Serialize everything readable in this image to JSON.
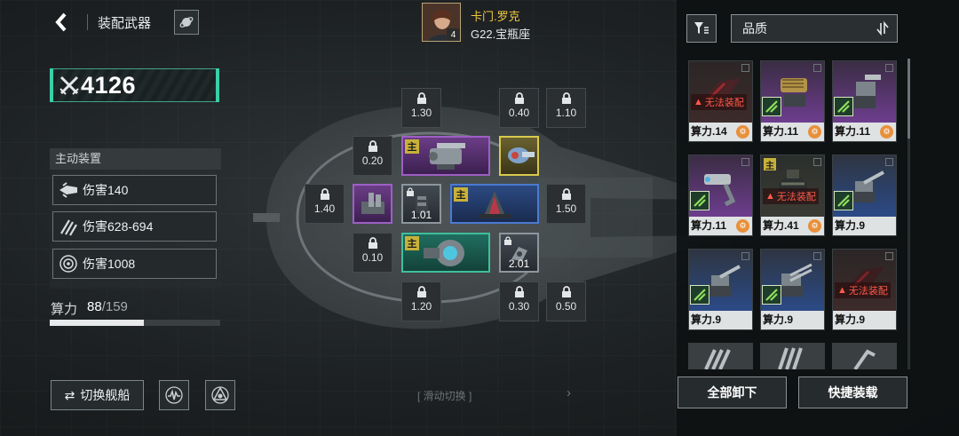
{
  "header": {
    "title": "装配武器",
    "captain": {
      "name": "卡门.罗克",
      "sub": "G22.宝瓶座",
      "level": "4"
    }
  },
  "power": {
    "value": "4126"
  },
  "devices": {
    "title": "主动装置",
    "items": [
      {
        "label": "伤害140",
        "icon": "jet-icon"
      },
      {
        "label": "伤害628-694",
        "icon": "claw-icon"
      },
      {
        "label": "伤害1008",
        "icon": "ring-icon"
      }
    ]
  },
  "compute": {
    "label": "算力",
    "used": "88",
    "total": "/159",
    "fraction": 0.553
  },
  "bottom": {
    "switch_label": "切换舰船",
    "slide_hint": "[ 滑动切换 ]"
  },
  "slots": {
    "locked": [
      "1.30",
      "0.40",
      "1.10",
      "0.20",
      "1.40",
      "1.50",
      "0.10",
      "1.20",
      "0.30",
      "0.50"
    ],
    "weapons": {
      "w1": {
        "tag": "主"
      },
      "w4": {
        "val": "1.01"
      },
      "w5": {
        "tag": "主"
      },
      "w6": {
        "tag": "主"
      },
      "w7": {
        "val": "2.01"
      }
    }
  },
  "inventory": {
    "sort_label": "品质",
    "warn_text": "无法装配",
    "main_tag": "主",
    "cards": [
      {
        "power": "算力.14",
        "warn": true
      },
      {
        "power": "算力.11"
      },
      {
        "power": "算力.11"
      },
      {
        "power": "算力.11"
      },
      {
        "power": "算力.41",
        "warn": true
      },
      {
        "power": "算力.9"
      },
      {
        "power": "算力.9"
      },
      {
        "power": "算力.9"
      },
      {
        "power": "算力.9",
        "warn": true
      }
    ],
    "unequip_all": "全部卸下",
    "quick_equip": "快捷装载"
  },
  "colors": {
    "accent_green": "#39d0a8",
    "captain_name": "#f1c83d",
    "warning": "#ff5a4a",
    "purple": "#9d5fc4",
    "blue": "#4b7ad0",
    "gold": "#d9c84e"
  }
}
